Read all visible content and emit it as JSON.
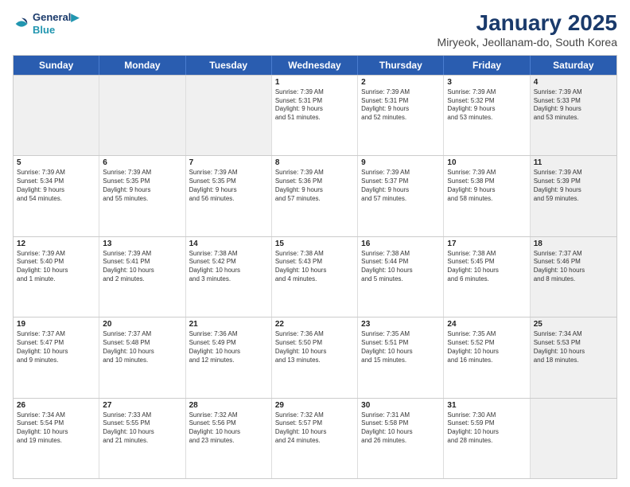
{
  "logo": {
    "line1": "General",
    "line2": "Blue"
  },
  "title": "January 2025",
  "subtitle": "Miryeok, Jeollanam-do, South Korea",
  "headers": [
    "Sunday",
    "Monday",
    "Tuesday",
    "Wednesday",
    "Thursday",
    "Friday",
    "Saturday"
  ],
  "weeks": [
    [
      {
        "day": "",
        "info": "",
        "shade": true
      },
      {
        "day": "",
        "info": "",
        "shade": true
      },
      {
        "day": "",
        "info": "",
        "shade": true
      },
      {
        "day": "1",
        "info": "Sunrise: 7:39 AM\nSunset: 5:31 PM\nDaylight: 9 hours\nand 51 minutes.",
        "shade": false
      },
      {
        "day": "2",
        "info": "Sunrise: 7:39 AM\nSunset: 5:31 PM\nDaylight: 9 hours\nand 52 minutes.",
        "shade": false
      },
      {
        "day": "3",
        "info": "Sunrise: 7:39 AM\nSunset: 5:32 PM\nDaylight: 9 hours\nand 53 minutes.",
        "shade": false
      },
      {
        "day": "4",
        "info": "Sunrise: 7:39 AM\nSunset: 5:33 PM\nDaylight: 9 hours\nand 53 minutes.",
        "shade": true
      }
    ],
    [
      {
        "day": "5",
        "info": "Sunrise: 7:39 AM\nSunset: 5:34 PM\nDaylight: 9 hours\nand 54 minutes.",
        "shade": false
      },
      {
        "day": "6",
        "info": "Sunrise: 7:39 AM\nSunset: 5:35 PM\nDaylight: 9 hours\nand 55 minutes.",
        "shade": false
      },
      {
        "day": "7",
        "info": "Sunrise: 7:39 AM\nSunset: 5:35 PM\nDaylight: 9 hours\nand 56 minutes.",
        "shade": false
      },
      {
        "day": "8",
        "info": "Sunrise: 7:39 AM\nSunset: 5:36 PM\nDaylight: 9 hours\nand 57 minutes.",
        "shade": false
      },
      {
        "day": "9",
        "info": "Sunrise: 7:39 AM\nSunset: 5:37 PM\nDaylight: 9 hours\nand 57 minutes.",
        "shade": false
      },
      {
        "day": "10",
        "info": "Sunrise: 7:39 AM\nSunset: 5:38 PM\nDaylight: 9 hours\nand 58 minutes.",
        "shade": false
      },
      {
        "day": "11",
        "info": "Sunrise: 7:39 AM\nSunset: 5:39 PM\nDaylight: 9 hours\nand 59 minutes.",
        "shade": true
      }
    ],
    [
      {
        "day": "12",
        "info": "Sunrise: 7:39 AM\nSunset: 5:40 PM\nDaylight: 10 hours\nand 1 minute.",
        "shade": false
      },
      {
        "day": "13",
        "info": "Sunrise: 7:39 AM\nSunset: 5:41 PM\nDaylight: 10 hours\nand 2 minutes.",
        "shade": false
      },
      {
        "day": "14",
        "info": "Sunrise: 7:38 AM\nSunset: 5:42 PM\nDaylight: 10 hours\nand 3 minutes.",
        "shade": false
      },
      {
        "day": "15",
        "info": "Sunrise: 7:38 AM\nSunset: 5:43 PM\nDaylight: 10 hours\nand 4 minutes.",
        "shade": false
      },
      {
        "day": "16",
        "info": "Sunrise: 7:38 AM\nSunset: 5:44 PM\nDaylight: 10 hours\nand 5 minutes.",
        "shade": false
      },
      {
        "day": "17",
        "info": "Sunrise: 7:38 AM\nSunset: 5:45 PM\nDaylight: 10 hours\nand 6 minutes.",
        "shade": false
      },
      {
        "day": "18",
        "info": "Sunrise: 7:37 AM\nSunset: 5:46 PM\nDaylight: 10 hours\nand 8 minutes.",
        "shade": true
      }
    ],
    [
      {
        "day": "19",
        "info": "Sunrise: 7:37 AM\nSunset: 5:47 PM\nDaylight: 10 hours\nand 9 minutes.",
        "shade": false
      },
      {
        "day": "20",
        "info": "Sunrise: 7:37 AM\nSunset: 5:48 PM\nDaylight: 10 hours\nand 10 minutes.",
        "shade": false
      },
      {
        "day": "21",
        "info": "Sunrise: 7:36 AM\nSunset: 5:49 PM\nDaylight: 10 hours\nand 12 minutes.",
        "shade": false
      },
      {
        "day": "22",
        "info": "Sunrise: 7:36 AM\nSunset: 5:50 PM\nDaylight: 10 hours\nand 13 minutes.",
        "shade": false
      },
      {
        "day": "23",
        "info": "Sunrise: 7:35 AM\nSunset: 5:51 PM\nDaylight: 10 hours\nand 15 minutes.",
        "shade": false
      },
      {
        "day": "24",
        "info": "Sunrise: 7:35 AM\nSunset: 5:52 PM\nDaylight: 10 hours\nand 16 minutes.",
        "shade": false
      },
      {
        "day": "25",
        "info": "Sunrise: 7:34 AM\nSunset: 5:53 PM\nDaylight: 10 hours\nand 18 minutes.",
        "shade": true
      }
    ],
    [
      {
        "day": "26",
        "info": "Sunrise: 7:34 AM\nSunset: 5:54 PM\nDaylight: 10 hours\nand 19 minutes.",
        "shade": false
      },
      {
        "day": "27",
        "info": "Sunrise: 7:33 AM\nSunset: 5:55 PM\nDaylight: 10 hours\nand 21 minutes.",
        "shade": false
      },
      {
        "day": "28",
        "info": "Sunrise: 7:32 AM\nSunset: 5:56 PM\nDaylight: 10 hours\nand 23 minutes.",
        "shade": false
      },
      {
        "day": "29",
        "info": "Sunrise: 7:32 AM\nSunset: 5:57 PM\nDaylight: 10 hours\nand 24 minutes.",
        "shade": false
      },
      {
        "day": "30",
        "info": "Sunrise: 7:31 AM\nSunset: 5:58 PM\nDaylight: 10 hours\nand 26 minutes.",
        "shade": false
      },
      {
        "day": "31",
        "info": "Sunrise: 7:30 AM\nSunset: 5:59 PM\nDaylight: 10 hours\nand 28 minutes.",
        "shade": false
      },
      {
        "day": "",
        "info": "",
        "shade": true
      }
    ]
  ]
}
